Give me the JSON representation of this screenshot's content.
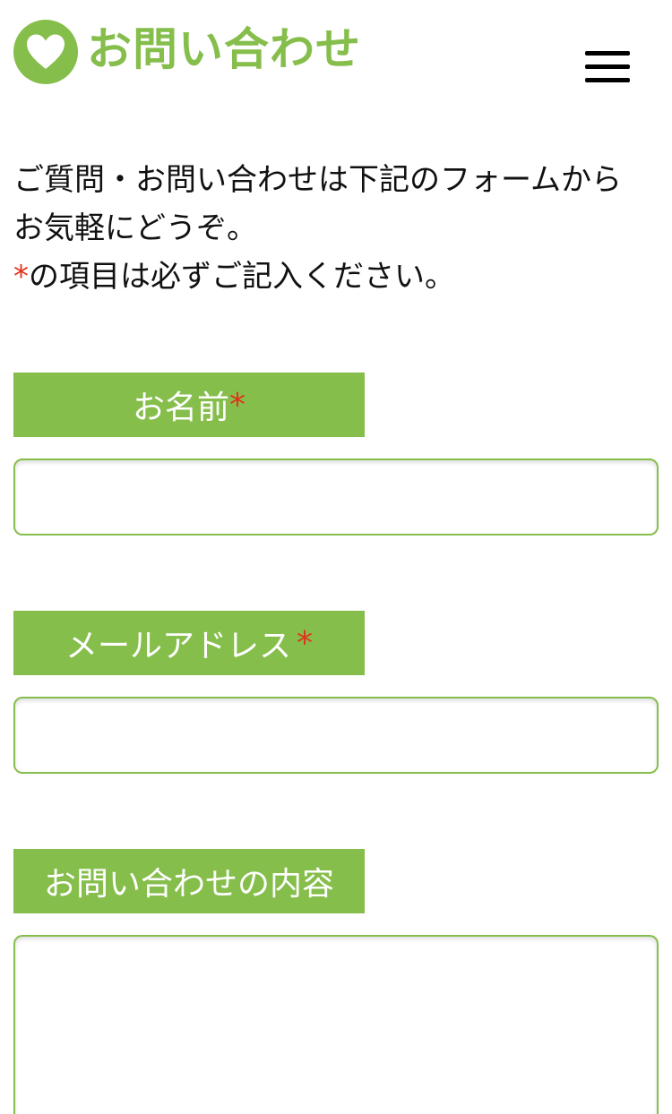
{
  "header": {
    "title": "お問い合わせ",
    "logo_icon": "heart-icon",
    "menu_icon": "hamburger-menu-icon",
    "brand_color": "#86be4c"
  },
  "intro": {
    "line1": "ご質問・お問い合わせは下記のフォームから",
    "line2": "お気軽にどうぞ。",
    "required_mark": "*",
    "line3": "の項目は必ずご記入ください。"
  },
  "form": {
    "name_label": "お名前",
    "name_required": "*",
    "name_value": "",
    "email_label": "メールアドレス",
    "email_required": "*",
    "email_value": "",
    "message_label": "お問い合わせの内容",
    "message_value": "",
    "required_color": "#e0341c"
  }
}
